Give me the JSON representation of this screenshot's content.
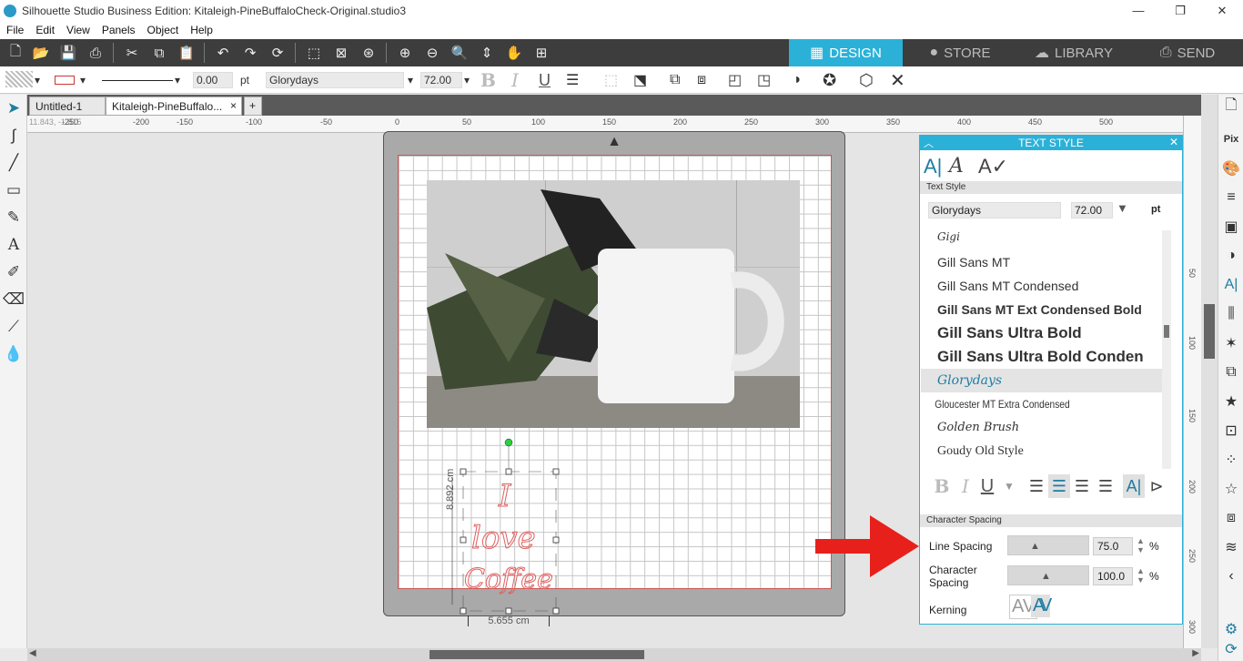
{
  "window": {
    "title": "Silhouette Studio Business Edition: Kitaleigh-PineBuffaloCheck-Original.studio3",
    "minimize": "—",
    "restore": "❐",
    "close": "✕"
  },
  "menu": [
    "File",
    "Edit",
    "View",
    "Panels",
    "Object",
    "Help"
  ],
  "nav_tabs": [
    {
      "label": "DESIGN",
      "icon": "grid-icon"
    },
    {
      "label": "STORE",
      "icon": "silhouette-s-icon"
    },
    {
      "label": "LIBRARY",
      "icon": "cloud-icon"
    },
    {
      "label": "SEND",
      "icon": "printer-icon"
    }
  ],
  "toolbar2": {
    "line_width": "0.00",
    "line_unit": "pt",
    "font_name": "Glorydays",
    "font_size": "72.00",
    "bold": "B",
    "italic": "I",
    "underline": "U"
  },
  "doc_tabs": [
    {
      "label": "Untitled-1",
      "close": "×"
    },
    {
      "label": "Kitaleigh-PineBuffalo...",
      "close": "×"
    },
    {
      "label": "+"
    }
  ],
  "coords": "11.843, -1.815",
  "ruler_top": [
    "-250",
    "-200",
    "-150",
    "-100",
    "-50",
    "0",
    "50",
    "100",
    "150",
    "200",
    "250",
    "300",
    "350",
    "400",
    "450",
    "500"
  ],
  "ruler_right": [
    "50",
    "100",
    "150",
    "200",
    "250",
    "300"
  ],
  "selection": {
    "height_label": "8.892 cm",
    "width_label": "5.655 cm",
    "text_lines": [
      "I",
      "love",
      "Coffee"
    ]
  },
  "panel": {
    "title": "TEXT STYLE",
    "section_text_style": "Text Style",
    "font_field": "Glorydays",
    "size_field": "72.00",
    "size_unit": "pt",
    "fonts": [
      "Gigi",
      "Gill Sans MT",
      "Gill Sans MT Condensed",
      "Gill Sans MT Ext Condensed Bold",
      "Gill Sans Ultra Bold",
      "Gill Sans Ultra Bold Conden",
      "Glorydays",
      "Gloucester MT Extra Condensed",
      "Golden Brush",
      "Goudy Old Style"
    ],
    "selected_font_index": 6,
    "fmt": {
      "bold": "B",
      "italic": "I",
      "underline": "U"
    },
    "section_char_spacing": "Character Spacing",
    "line_spacing_label": "Line Spacing",
    "line_spacing_value": "75.0",
    "char_spacing_label_1": "Character",
    "char_spacing_label_2": "Spacing",
    "char_spacing_value": "100.0",
    "percent": "%",
    "kerning_label": "Kerning",
    "kerning_text": "AV"
  },
  "colors": {
    "accent": "#2bb1d8",
    "dark_toolbar": "#3d3d3d",
    "arrow": "#e8201c",
    "text_outline": "#e06060"
  }
}
